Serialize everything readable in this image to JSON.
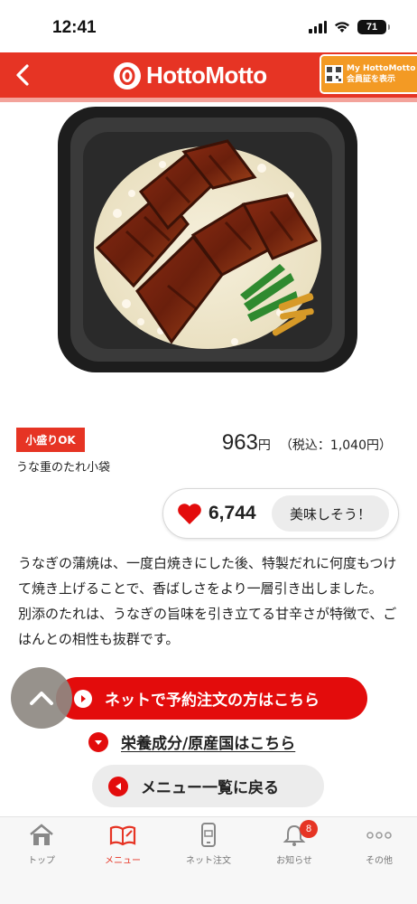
{
  "status_bar": {
    "time": "12:41",
    "battery": "71"
  },
  "header": {
    "logo_text": "HottoMotto",
    "member_line1": "My HottoMotto",
    "member_line2": "会員証を表示"
  },
  "product": {
    "badge": "小盛りOK",
    "note": "うな重のたれ小袋",
    "price": "963",
    "price_unit": "円",
    "price_tax": "（税込：1,040円）",
    "likes": "6,744",
    "oishi_label": "美味しそう！",
    "description": [
      "うなぎの蒲焼は、一度白焼きにした後、特製だれに何度もつけて焼き上げることで、香ばしさをより一層引き出しました。",
      "別添のたれは、うなぎの旨味を引き立てる甘辛さが特徴で、ごはんとの相性も抜群です。"
    ]
  },
  "actions": {
    "reserve": "ネットで予約注文の方はこちら",
    "nutrition": "栄養成分/原産国はこちら",
    "back_menu": "メニュー一覧に戻る"
  },
  "nav": {
    "items": [
      {
        "label": "トップ",
        "icon": "home-icon"
      },
      {
        "label": "メニュー",
        "icon": "menu-book-icon",
        "active": true
      },
      {
        "label": "ネット注文",
        "icon": "phone-order-icon"
      },
      {
        "label": "お知らせ",
        "icon": "bell-icon",
        "badge": "8"
      },
      {
        "label": "その他",
        "icon": "more-icon"
      }
    ]
  },
  "colors": {
    "brand_red": "#e63424",
    "button_red": "#e30c0c",
    "member_orange": "#f39a24"
  }
}
